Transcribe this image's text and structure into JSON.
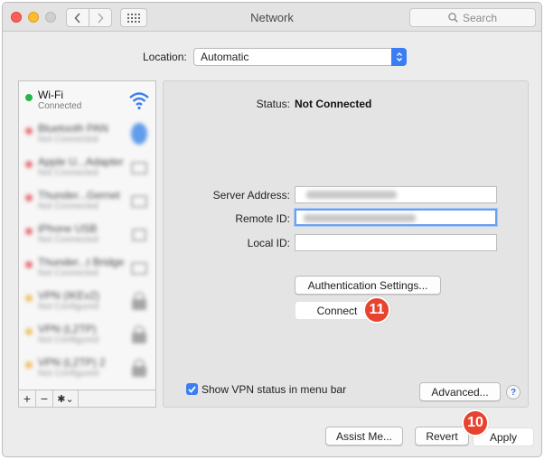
{
  "window": {
    "title": "Network"
  },
  "toolbar": {
    "search_placeholder": "Search"
  },
  "location": {
    "label": "Location:",
    "value": "Automatic"
  },
  "sidebar": {
    "items": [
      {
        "name": "Wi-Fi",
        "status": "Connected",
        "status_color": "#28b44a",
        "icon": "wifi-icon"
      },
      {
        "name": "Bluetooth PAN",
        "status": "Not Connected",
        "status_color": "#e0464a",
        "icon": "bluetooth-icon"
      },
      {
        "name": "Apple U...Adapter",
        "status": "Not Connected",
        "status_color": "#e0464a",
        "icon": "ethernet-icon"
      },
      {
        "name": "Thunder...Gernet",
        "status": "Not Connected",
        "status_color": "#e0464a",
        "icon": "ethernet-icon"
      },
      {
        "name": "iPhone USB",
        "status": "Not Connected",
        "status_color": "#e0464a",
        "icon": "phone-icon"
      },
      {
        "name": "Thunder...t Bridge",
        "status": "Not Connected",
        "status_color": "#e0464a",
        "icon": "bridge-icon"
      },
      {
        "name": "VPN (IKEv2)",
        "status": "Not Configured",
        "status_color": "#e8b13a",
        "icon": "vpn-lock-icon"
      },
      {
        "name": "VPN (L2TP)",
        "status": "Not Configured",
        "status_color": "#e8b13a",
        "icon": "vpn-lock-icon"
      },
      {
        "name": "VPN (L2TP) 2",
        "status": "Not Configured",
        "status_color": "#e8b13a",
        "icon": "vpn-lock-icon"
      }
    ],
    "tools": {
      "add": "+",
      "remove": "−",
      "gear": "✱⌄"
    }
  },
  "pane": {
    "status_label": "Status:",
    "status_value": "Not Connected",
    "server_address_label": "Server Address:",
    "remote_id_label": "Remote ID:",
    "local_id_label": "Local ID:",
    "auth_button": "Authentication Settings...",
    "connect_button": "Connect",
    "show_vpn_label": "Show VPN status in menu bar",
    "advanced_button": "Advanced...",
    "help": "?"
  },
  "badges": {
    "connect_step": "11",
    "apply_step": "10",
    "color": "#e8432e"
  },
  "footer": {
    "assist_button": "Assist Me...",
    "revert_button": "Revert",
    "apply_button": "Apply"
  },
  "colors": {
    "accent": "#3b7ef3",
    "window_bg": "#ececec"
  }
}
